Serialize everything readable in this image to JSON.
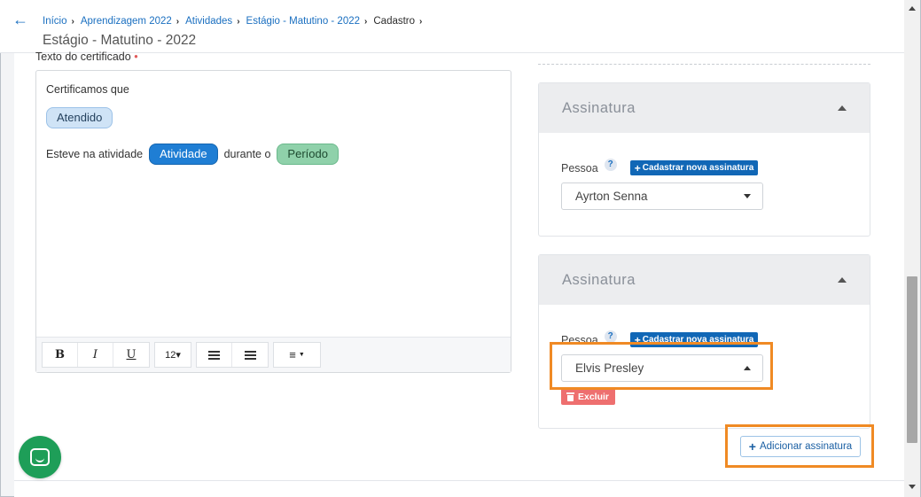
{
  "header": {
    "back_icon": "arrow-left-icon",
    "breadcrumb": [
      "Início",
      "Aprendizagem 2022",
      "Atividades",
      "Estágio - Matutino - 2022",
      "Cadastro"
    ],
    "title": "Estágio - Matutino - 2022"
  },
  "certificate": {
    "label": "Texto do certificado",
    "required_mark": "•",
    "line1": "Certificamos que",
    "tag_attendee": "Atendido",
    "line3_prefix": "Esteve na atividade",
    "tag_activity": "Atividade",
    "line3_middle": "durante o",
    "tag_period": "Período"
  },
  "toolbar": {
    "bold": "B",
    "italic": "I",
    "underline": "U",
    "font_size": "12▾",
    "align_caret": "▼"
  },
  "signatures": [
    {
      "title": "Assinatura",
      "pessoa_label": "Pessoa",
      "help": "?",
      "new_button": "Cadastrar nova assinatura",
      "selected": "Ayrton Senna"
    },
    {
      "title": "Assinatura",
      "pessoa_label": "Pessoa",
      "help": "?",
      "new_button": "Cadastrar nova assinatura",
      "selected": "Elvis Presley",
      "delete_button": "Excluir"
    }
  ],
  "add_signature_button": "Adicionar assinatura",
  "colors": {
    "link": "#1a6fc0",
    "highlight": "#f08a24",
    "chat": "#1e9e58",
    "danger": "#ee6f6f",
    "primary": "#1167b6"
  }
}
